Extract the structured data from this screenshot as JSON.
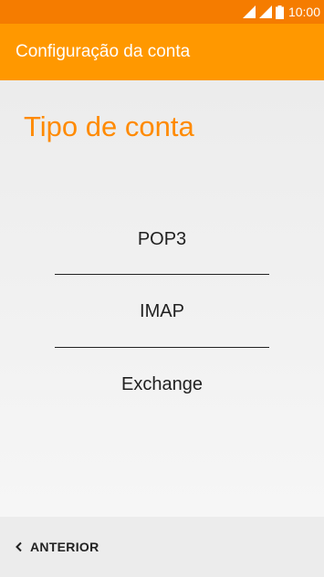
{
  "status_bar": {
    "time": "10:00",
    "icons": [
      "signal-icon",
      "signal-icon",
      "battery-icon"
    ]
  },
  "app_bar": {
    "title": "Configuração da conta"
  },
  "main": {
    "heading": "Tipo de conta",
    "options": [
      {
        "label": "POP3"
      },
      {
        "label": "IMAP"
      },
      {
        "label": "Exchange"
      }
    ]
  },
  "footer": {
    "back_label": "ANTERIOR",
    "back_icon": "chevron-left-icon"
  },
  "colors": {
    "status_bar": "#f57c00",
    "app_bar": "#ff9800",
    "accent": "#ff8a00"
  }
}
